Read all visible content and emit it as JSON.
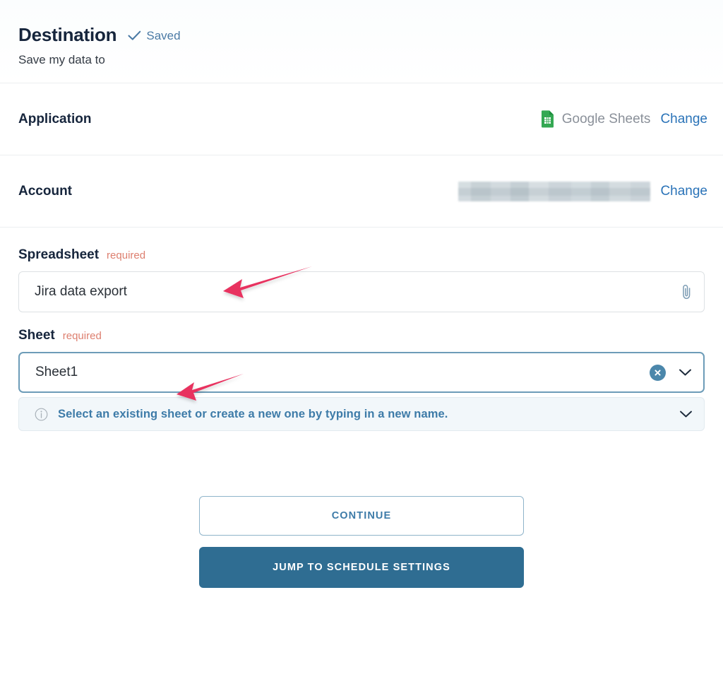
{
  "header": {
    "title": "Destination",
    "saved_label": "Saved",
    "saved_icon": "check-icon",
    "subtitle": "Save my data to"
  },
  "rows": [
    {
      "label": "Application",
      "value": "Google Sheets",
      "icon": "google-sheets-icon",
      "action_label": "Change"
    },
    {
      "label": "Account",
      "value": "",
      "redacted": true,
      "action_label": "Change"
    }
  ],
  "fields": {
    "spreadsheet": {
      "label": "Spreadsheet",
      "required_label": "required",
      "value": "Jira data export",
      "placeholder": "",
      "adornment_icon": "paperclip-icon"
    },
    "sheet": {
      "label": "Sheet",
      "required_label": "required",
      "value": "Sheet1",
      "placeholder": "",
      "clear_icon": "clear-circle-x-icon",
      "dropdown_icon": "chevron-down-icon",
      "info": {
        "icon": "info-circle-icon",
        "text": "Select an existing sheet or create a new one by typing in a new name.",
        "expand_icon": "chevron-down-icon"
      }
    }
  },
  "actions": {
    "continue_label": "CONTINUE",
    "jump_label": "JUMP TO SCHEDULE SETTINGS"
  },
  "annotations": [
    {
      "name": "arrow-pointing-to-spreadsheet-field",
      "color": "#e8305f"
    },
    {
      "name": "arrow-pointing-to-sheet-field",
      "color": "#e8305f"
    }
  ],
  "colors": {
    "accent_blue": "#2f6d92",
    "link_blue": "#2a73b8",
    "required_red": "#dd7f6f",
    "arrow_pink": "#e8305f",
    "sheets_green": "#34a853"
  }
}
